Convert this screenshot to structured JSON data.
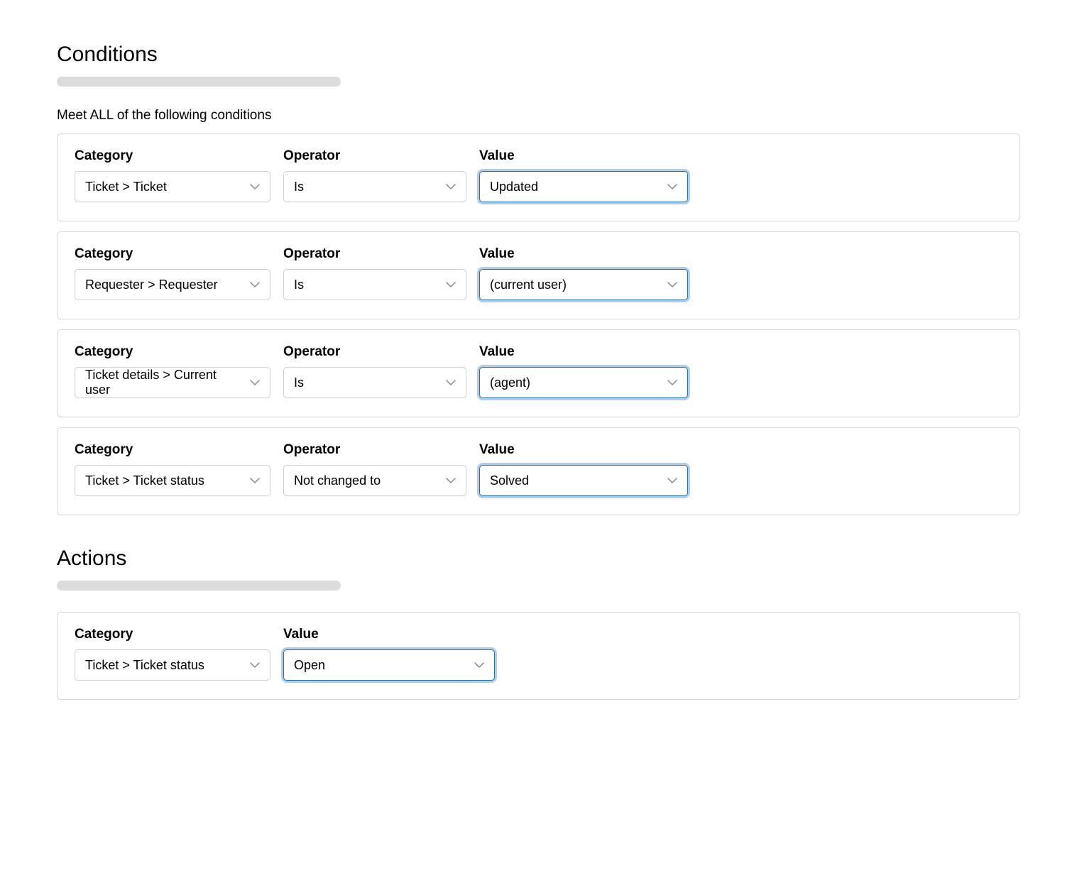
{
  "conditions": {
    "title": "Conditions",
    "subtitle": "Meet ALL of the following conditions",
    "labels": {
      "category": "Category",
      "operator": "Operator",
      "value": "Value"
    },
    "rows": [
      {
        "category": "Ticket > Ticket",
        "operator": "Is",
        "value": "Updated"
      },
      {
        "category": "Requester > Requester",
        "operator": "Is",
        "value": "(current user)"
      },
      {
        "category": "Ticket details > Current user",
        "operator": "Is",
        "value": "(agent)"
      },
      {
        "category": "Ticket > Ticket status",
        "operator": "Not changed to",
        "value": "Solved"
      }
    ]
  },
  "actions": {
    "title": "Actions",
    "labels": {
      "category": "Category",
      "value": "Value"
    },
    "rows": [
      {
        "category": "Ticket > Ticket status",
        "value": "Open"
      }
    ]
  }
}
